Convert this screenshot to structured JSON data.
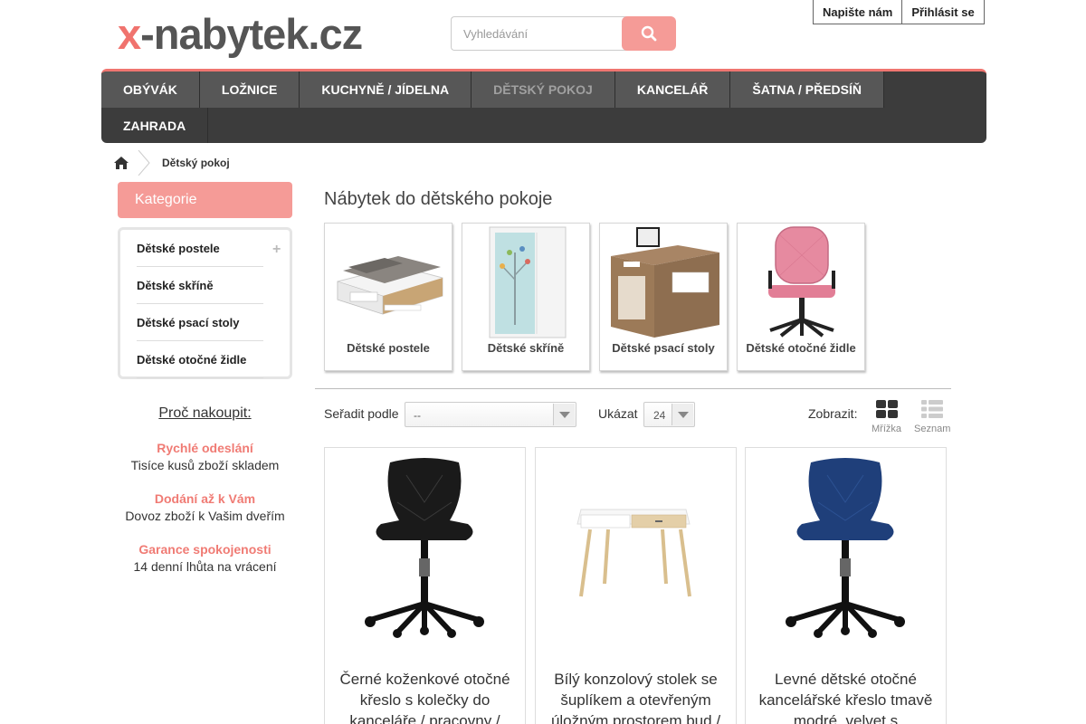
{
  "header": {
    "logo_x": "x",
    "logo_rest": "-nabytek.cz",
    "search_placeholder": "Vyhledávání",
    "links": [
      "Napište nám",
      "Přihlásit se"
    ]
  },
  "nav": {
    "row1": [
      "Obývák",
      "Ložnice",
      "Kuchyně / Jídelna",
      "Dětský pokoj",
      "Kancelář",
      "Šatna / Předsíň"
    ],
    "row2": [
      "Zahrada"
    ],
    "active": "Dětský pokoj"
  },
  "breadcrumb": {
    "current": "Dětský pokoj"
  },
  "sidebar": {
    "title": "Kategorie",
    "items": [
      "Dětské postele",
      "Dětské skříně",
      "Dětské psací stoly",
      "Dětské otočné židle"
    ],
    "why_title": "Proč nakoupit:",
    "why": [
      {
        "heading": "Rychlé odeslání",
        "text": "Tisíce kusů zboží skladem"
      },
      {
        "heading": "Dodání až k Vám",
        "text": "Dovoz zboží k Vašim dveřím"
      },
      {
        "heading": "Garance spokojenosti",
        "text": "14 denní lhůta na vrácení"
      }
    ]
  },
  "main": {
    "title": "Nábytek do dětského pokoje",
    "subcategories": [
      "Dětské postele",
      "Dětské skříně",
      "Dětské psací stoly",
      "Dětské otočné židle"
    ],
    "toolbar": {
      "sort_label": "Seřadit podle",
      "sort_value": "--",
      "show_label": "Ukázat",
      "show_value": "24",
      "view_label": "Zobrazit:",
      "grid_label": "Mřížka",
      "list_label": "Seznam"
    },
    "products": [
      {
        "name": "Černé koženkové otočné křeslo s kolečky do kanceláře / pracovny /",
        "color": "#1a1a1a"
      },
      {
        "name": "Bílý konzolový stolek se šuplíkem a otevřeným úložným prostorem bud /",
        "color": "#ffffff"
      },
      {
        "name": "Levné dětské otočné kancelářské křeslo tmavě modré, velvet s prošíváním",
        "color": "#1f3f7a"
      }
    ]
  },
  "colors": {
    "accent": "#f59b97",
    "accent_text": "#f07b74",
    "nav_bg": "#575757",
    "nav_bg2": "#3c3c3c"
  }
}
